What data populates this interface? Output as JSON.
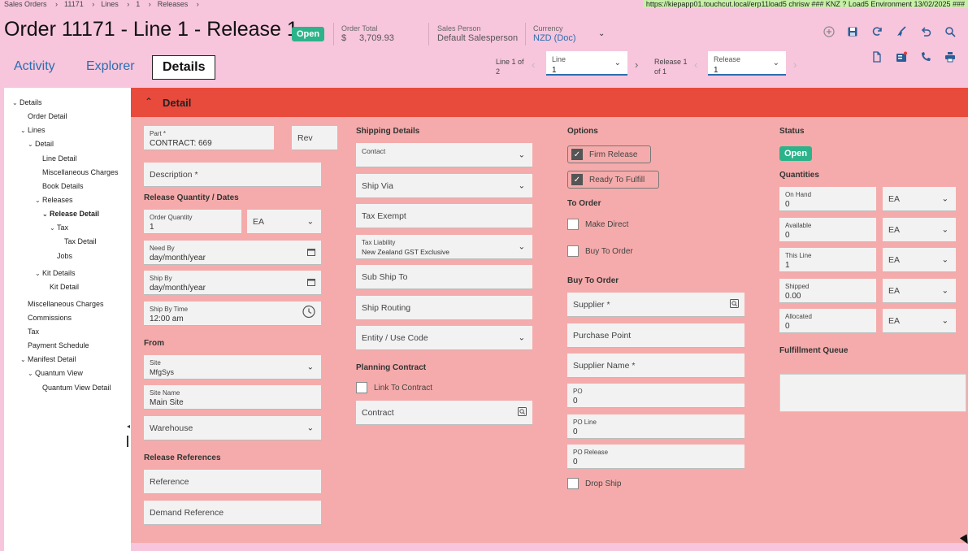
{
  "breadcrumb": [
    "Sales Orders",
    "11171",
    "Lines",
    "1",
    "Releases"
  ],
  "env_bar": "https://kiepapp01.touchcut.local/erp11load5   chrisw   ### KNZ ? Load5 Environment 13/02/2025 ###",
  "page_title": "Order 11171 - Line 1 - Release 1",
  "status_badge": "Open",
  "header": {
    "order_total_label": "Order Total",
    "order_total_currency": "$",
    "order_total_value": "3,709.93",
    "sales_person_label": "Sales Person",
    "sales_person_value": "Default Salesperson",
    "currency_label": "Currency",
    "currency_value": "NZD (Doc)"
  },
  "tabs": [
    "Activity",
    "Explorer",
    "Details"
  ],
  "nav": {
    "line_of_a": "Line 1 of",
    "line_of_b": "2",
    "line_label": "Line",
    "line_value": "1",
    "release_of_a": "Release 1",
    "release_of_b": "of 1",
    "release_label": "Release",
    "release_value": "1"
  },
  "toolbar_icons": [
    "add-icon",
    "save-icon",
    "refresh-icon",
    "clear-icon",
    "undo-icon",
    "search-icon"
  ],
  "toolbar_icons2": [
    "new-document-icon",
    "attachment-icon",
    "phone-icon",
    "print-icon"
  ],
  "tree": [
    {
      "label": "Details",
      "caret": "v",
      "indent": 0
    },
    {
      "label": "Order Detail",
      "caret": "",
      "indent": 1
    },
    {
      "label": "Lines",
      "caret": "v",
      "indent": 1
    },
    {
      "label": "Detail",
      "caret": "v",
      "indent": 2
    },
    {
      "label": "Line Detail",
      "caret": "",
      "indent": 3
    },
    {
      "label": "Miscellaneous Charges",
      "caret": "",
      "indent": 3
    },
    {
      "label": "Book Details",
      "caret": "",
      "indent": 3
    },
    {
      "label": "Releases",
      "caret": "v",
      "indent": 3
    },
    {
      "label": "Release Detail",
      "caret": "v",
      "indent": 4
    },
    {
      "label": "Tax",
      "caret": "v",
      "indent": 5
    },
    {
      "label": "Tax Detail",
      "caret": "",
      "indent": 6
    },
    {
      "label": "Jobs",
      "caret": "",
      "indent": 5
    },
    {
      "label": "Kit Details",
      "caret": "v",
      "indent": 3
    },
    {
      "label": "Kit Detail",
      "caret": "",
      "indent": 4
    },
    {
      "label": "Miscellaneous Charges",
      "caret": "",
      "indent": 1
    },
    {
      "label": "Commissions",
      "caret": "",
      "indent": 1
    },
    {
      "label": "Tax",
      "caret": "",
      "indent": 1
    },
    {
      "label": "Payment Schedule",
      "caret": "",
      "indent": 1
    },
    {
      "label": "Manifest Detail",
      "caret": "v",
      "indent": 1
    },
    {
      "label": "Quantum View",
      "caret": "v",
      "indent": 2
    },
    {
      "label": "Quantum View Detail",
      "caret": "",
      "indent": 3
    }
  ],
  "detail_header": "Detail",
  "col1": {
    "part_label": "Part *",
    "part_value": "CONTRACT: 669",
    "rev": "Rev",
    "description": "Description *",
    "release_qty_section": "Release Quantity / Dates",
    "order_qty_label": "Order Quantity",
    "order_qty_value": "1",
    "uom": "EA",
    "need_by_label": "Need By",
    "need_by_value": "day/month/year",
    "ship_by_label": "Ship By",
    "ship_by_value": "day/month/year",
    "ship_time_label": "Ship By Time",
    "ship_time_value": "12:00 am",
    "from_section": "From",
    "site_label": "Site",
    "site_value": "MfgSys",
    "site_name_label": "Site Name",
    "site_name_value": "Main Site",
    "warehouse": "Warehouse",
    "release_refs_section": "Release References",
    "reference": "Reference",
    "demand_reference": "Demand Reference"
  },
  "col2": {
    "shipping_section": "Shipping Details",
    "contact": "Contact",
    "ship_via": "Ship Via",
    "tax_exempt": "Tax Exempt",
    "tax_liability_label": "Tax Liability",
    "tax_liability_value": "New Zealand GST Exclusive",
    "sub_ship_to": "Sub Ship To",
    "ship_routing": "Ship Routing",
    "entity_use_code": "Entity / Use Code",
    "planning_section": "Planning Contract",
    "link_to_contract": "Link To Contract",
    "contract": "Contract"
  },
  "col3": {
    "options_section": "Options",
    "firm_release": "Firm Release",
    "ready_to_fulfill": "Ready To Fulfill",
    "to_order_section": "To Order",
    "make_direct": "Make Direct",
    "buy_to_order": "Buy To Order",
    "buy_to_order_section": "Buy To Order",
    "supplier": "Supplier *",
    "purchase_point": "Purchase Point",
    "supplier_name": "Supplier Name *",
    "po_label": "PO",
    "po_value": "0",
    "po_line_label": "PO Line",
    "po_line_value": "0",
    "po_release_label": "PO Release",
    "po_release_value": "0",
    "drop_ship": "Drop Ship"
  },
  "col4": {
    "status_section": "Status",
    "status_value": "Open",
    "quantities_section": "Quantities",
    "quantities": [
      {
        "label": "On Hand",
        "value": "0",
        "uom": "EA"
      },
      {
        "label": "Available",
        "value": "0",
        "uom": "EA"
      },
      {
        "label": "This Line",
        "value": "1",
        "uom": "EA"
      },
      {
        "label": "Shipped",
        "value": "0.00",
        "uom": "EA"
      },
      {
        "label": "Allocated",
        "value": "0",
        "uom": "EA"
      }
    ],
    "fulfillment_section": "Fulfillment Queue"
  },
  "colors": {
    "accent": "#2a6fb0",
    "header_red": "#e84a3c",
    "panel": "#f5abab",
    "badge": "#2db38a"
  }
}
